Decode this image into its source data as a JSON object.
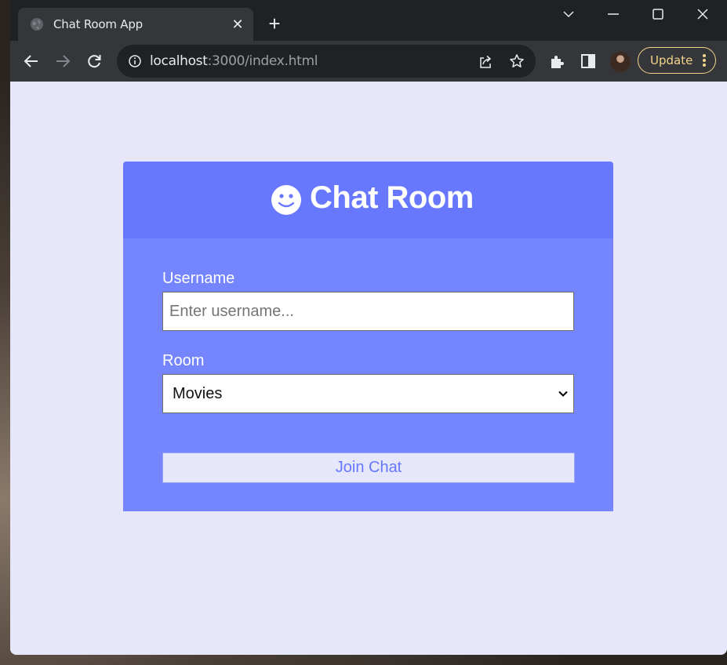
{
  "browser": {
    "tab_title": "Chat Room App",
    "url_host": "localhost",
    "url_rest": ":3000/index.html",
    "update_label": "Update"
  },
  "page": {
    "title": "Chat Room",
    "username_label": "Username",
    "username_placeholder": "Enter username...",
    "room_label": "Room",
    "room_selected": "Movies",
    "join_label": "Join Chat"
  },
  "colors": {
    "header": "#6777fe",
    "body": "#7485fe",
    "page_bg": "#e6e7fb"
  }
}
